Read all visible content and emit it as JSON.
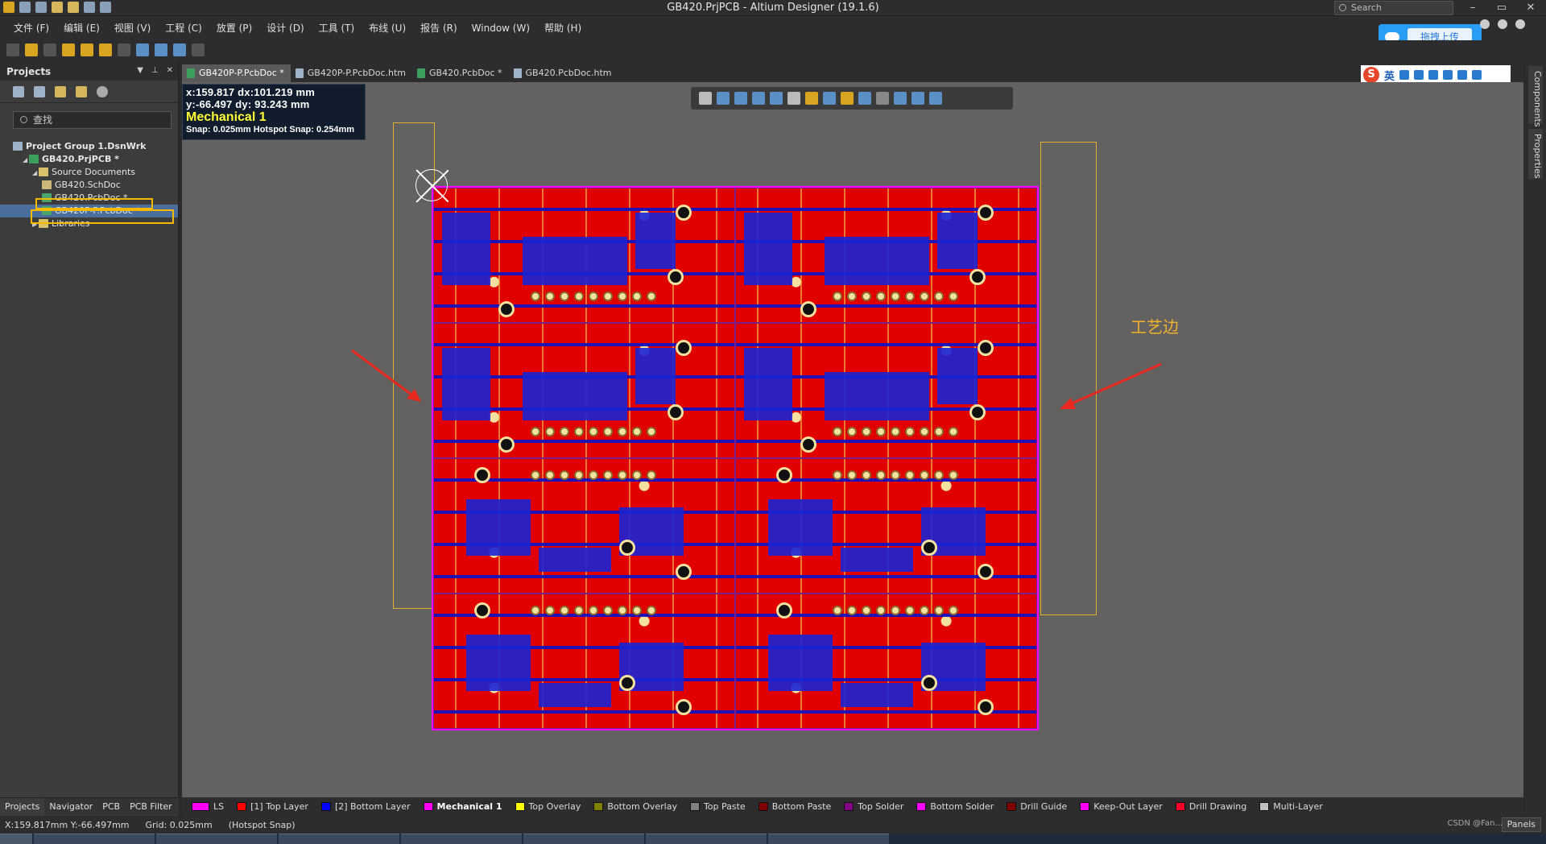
{
  "window": {
    "title": "GB420.PrjPCB - Altium Designer (19.1.6)",
    "search_placeholder": "Search"
  },
  "menu": [
    "文件 (F)",
    "编辑 (E)",
    "视图 (V)",
    "工程 (C)",
    "放置 (P)",
    "设计 (D)",
    "工具 (T)",
    "布线 (U)",
    "报告 (R)",
    "Window (W)",
    "帮助 (H)"
  ],
  "upload_button": "拖拽上传",
  "projects_panel": {
    "title": "Projects",
    "search_placeholder": "查找",
    "tree": [
      {
        "label": "Project Group 1.DsnWrk",
        "icon": "workspace-icon",
        "level": 0,
        "bold": true
      },
      {
        "label": "GB420.PrjPCB *",
        "icon": "pcb-project-icon",
        "level": 1,
        "bold": true
      },
      {
        "label": "Source Documents",
        "icon": "folder-icon",
        "level": 2
      },
      {
        "label": "GB420.SchDoc",
        "icon": "schematic-icon",
        "level": 3
      },
      {
        "label": "GB420.PcbDoc *",
        "icon": "pcb-doc-icon",
        "level": 3,
        "highlight": true
      },
      {
        "label": "GB420P-P.PcbDoc *",
        "icon": "pcb-doc-icon",
        "level": 3,
        "selected": true,
        "highlight": true
      },
      {
        "label": "Libraries",
        "icon": "folder-icon",
        "level": 2
      }
    ],
    "bottom_tabs": [
      "Projects",
      "Navigator",
      "PCB",
      "PCB Filter"
    ]
  },
  "doc_tabs": [
    {
      "label": "GB420P-P.PcbDoc *",
      "active": true
    },
    {
      "label": "GB420P-P.PcbDoc.htm"
    },
    {
      "label": "GB420.PcbDoc *"
    },
    {
      "label": "GB420.PcbDoc.htm"
    }
  ],
  "ime": {
    "logo": "S",
    "lang": "英"
  },
  "hud": {
    "line1": "x:159.817   dx:101.219  mm",
    "line2": "y:-66.497    dy: 93.243   mm",
    "layer": "Mechanical 1",
    "snap": "Snap: 0.025mm Hotspot Snap: 0.254mm"
  },
  "annotation": "工艺边",
  "layers": [
    {
      "label": "LS",
      "color": "#ff00ff"
    },
    {
      "label": "[1] Top Layer",
      "color": "#ff0000"
    },
    {
      "label": "[2] Bottom Layer",
      "color": "#0000ff"
    },
    {
      "label": "Mechanical 1",
      "color": "#ff00ff",
      "active": true
    },
    {
      "label": "Top Overlay",
      "color": "#ffff00"
    },
    {
      "label": "Bottom Overlay",
      "color": "#808000"
    },
    {
      "label": "Top Paste",
      "color": "#808080"
    },
    {
      "label": "Bottom Paste",
      "color": "#800000"
    },
    {
      "label": "Top Solder",
      "color": "#800080"
    },
    {
      "label": "Bottom Solder",
      "color": "#ff00ff"
    },
    {
      "label": "Drill Guide",
      "color": "#800000"
    },
    {
      "label": "Keep-Out Layer",
      "color": "#ff00ff"
    },
    {
      "label": "Drill Drawing",
      "color": "#ff002a"
    },
    {
      "label": "Multi-Layer",
      "color": "#c0c0c0"
    }
  ],
  "right_panels": [
    "Components",
    "Properties"
  ],
  "status": {
    "coords": "X:159.817mm Y:-66.497mm",
    "grid": "Grid: 0.025mm",
    "snap": "(Hotspot Snap)",
    "watermark": "CSDN @Fan...",
    "panels": "Panels"
  }
}
